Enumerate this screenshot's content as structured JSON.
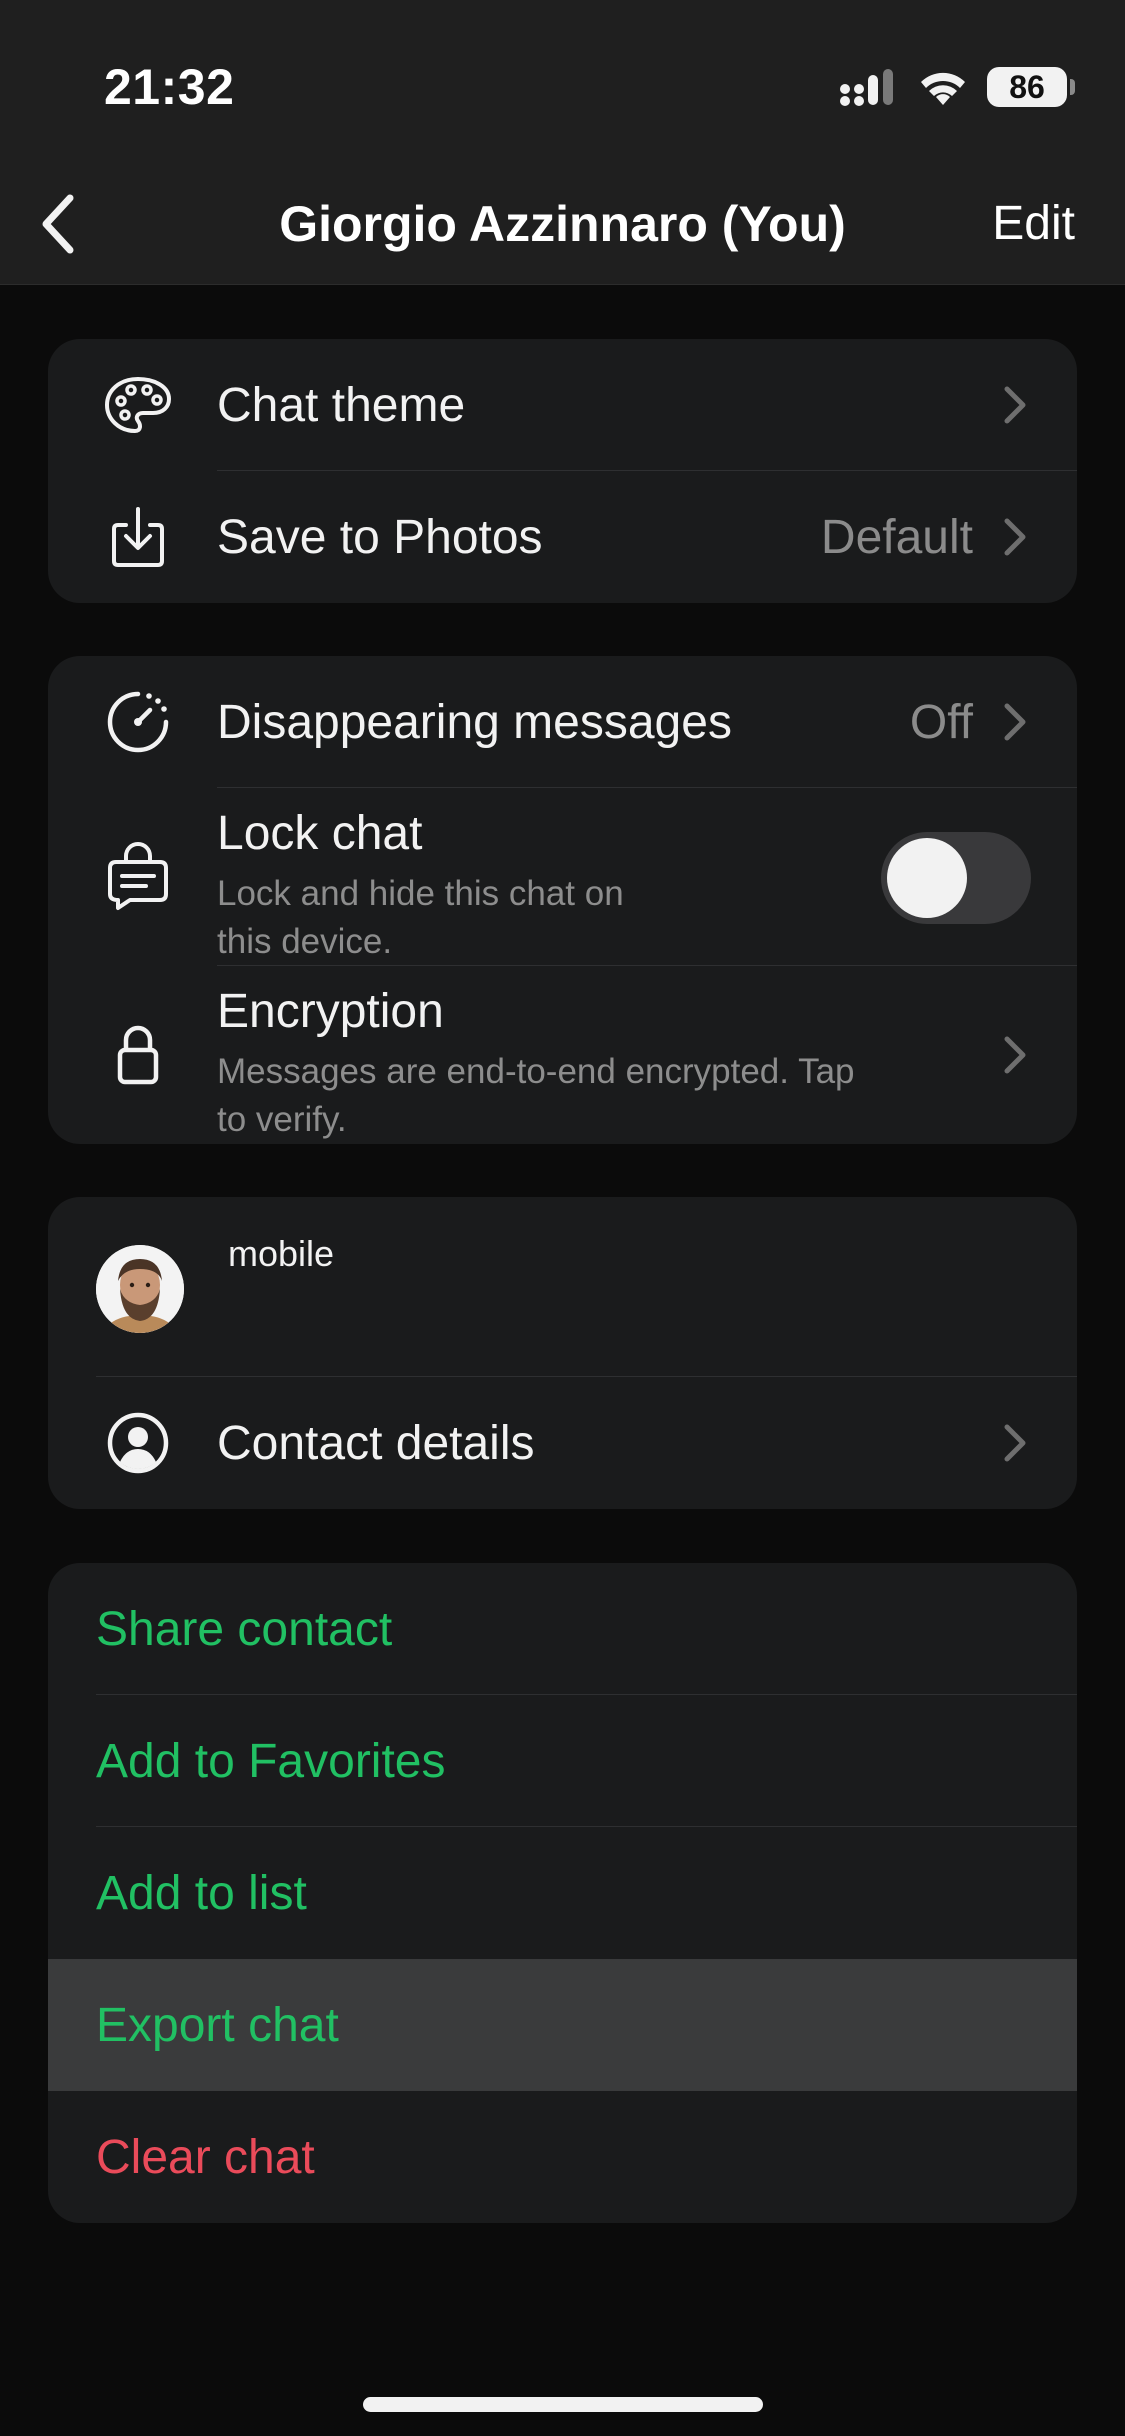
{
  "status": {
    "time": "21:32",
    "battery": "86"
  },
  "nav": {
    "title": "Giorgio Azzinnaro (You)",
    "edit": "Edit"
  },
  "group1": {
    "chat_theme": "Chat theme",
    "save_to_photos": "Save to Photos",
    "save_to_photos_value": "Default"
  },
  "group2": {
    "disappearing": "Disappearing messages",
    "disappearing_value": "Off",
    "lock_chat": "Lock chat",
    "lock_chat_desc_1": "Lock and hide this chat on",
    "lock_chat_desc_2": "this device.",
    "lock_chat_enabled": false,
    "encryption": "Encryption",
    "encryption_desc_1": "Messages are end-to-end encrypted. Tap",
    "encryption_desc_2": "to verify."
  },
  "group3": {
    "phone_label": "mobile",
    "contact_details": "Contact details"
  },
  "actions": {
    "share_contact": "Share contact",
    "add_favorites": "Add to Favorites",
    "add_list": "Add to list",
    "export_chat": "Export chat",
    "clear_chat": "Clear chat"
  },
  "colors": {
    "accent_green": "#21c063",
    "destructive_red": "#ea4b5a",
    "chevron": "#6e6e6e"
  },
  "icons": [
    "back-chevron-icon",
    "palette-icon",
    "save-download-icon",
    "timer-icon",
    "lock-chat-icon",
    "padlock-icon",
    "avatar",
    "person-circle-icon",
    "chevron-right-icon"
  ]
}
